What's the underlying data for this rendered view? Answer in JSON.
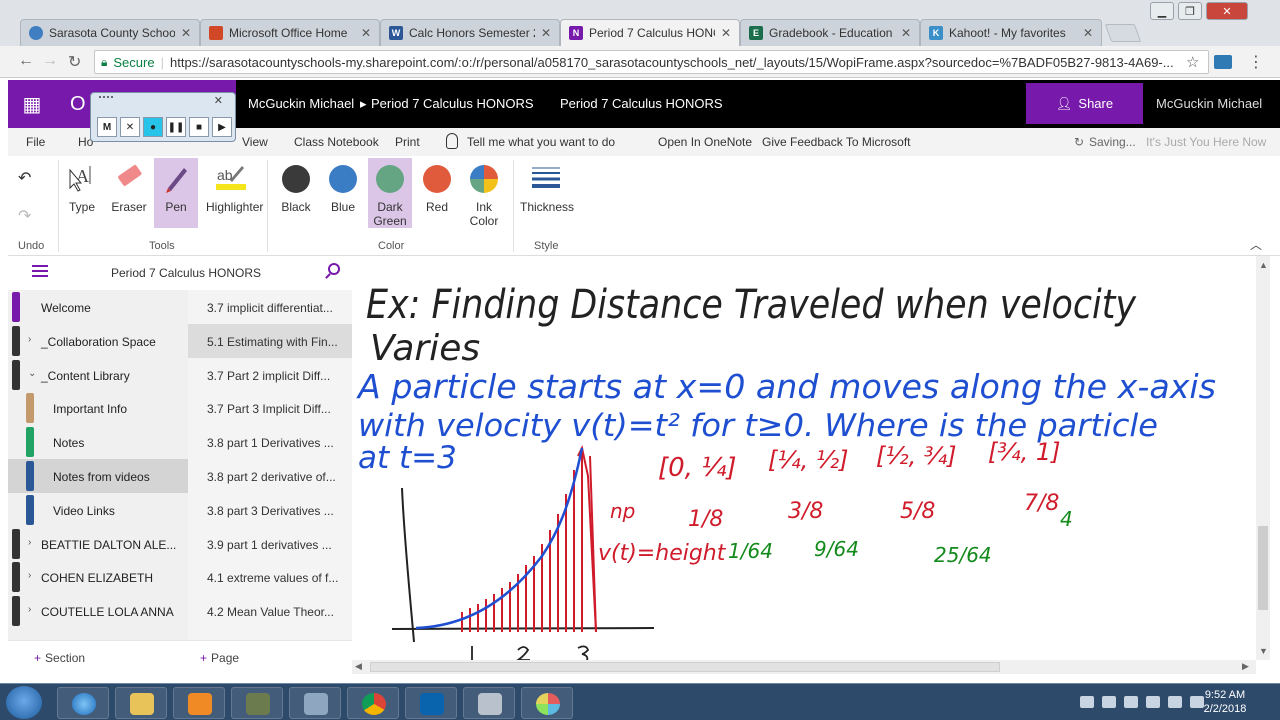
{
  "browser": {
    "tabs": [
      {
        "title": "Sarasota County Schools",
        "icon_color": "#3f7fc1",
        "active": false
      },
      {
        "title": "Microsoft Office Home",
        "icon_color": "#d24726",
        "active": false
      },
      {
        "title": "Calc Honors Semester 2",
        "icon_color": "#2b5797",
        "active": false
      },
      {
        "title": "Period 7 Calculus HONORS",
        "icon_color": "#7719aa",
        "active": true
      },
      {
        "title": "Gradebook - Education",
        "icon_color": "#1b6e4b",
        "active": false
      },
      {
        "title": "Kahoot! - My favorites",
        "icon_color": "#3a8fc9",
        "active": false
      }
    ],
    "tab_close": "✕",
    "secure_label": "Secure",
    "url": "https://sarasotacountyschools-my.sharepoint.com/:o:/r/personal/a058170_sarasotacountyschools_net/_layouts/15/WopiFrame.aspx?sourcedoc=%7BADF05B27-9813-4A69-..."
  },
  "office": {
    "brand": "O",
    "breadcrumb_user": "McGuckin Michael",
    "breadcrumb_notebook": "Period 7 Calculus HONORS",
    "page_notebook": "Period 7 Calculus HONORS",
    "share_label": "Share",
    "user_name": "McGuckin Michael"
  },
  "recorder": {
    "mode_label": "M",
    "close": "✕"
  },
  "ribbon_tabs": {
    "file": "File",
    "home": "Ho",
    "view": "View",
    "class_notebook": "Class Notebook",
    "print": "Print",
    "tell_me": "Tell me what you want to do",
    "open_in_onenote": "Open In OneNote",
    "feedback": "Give Feedback To Microsoft",
    "saving": "Saving...",
    "presence": "It's Just You Here Now"
  },
  "ribbon": {
    "tools": [
      {
        "label": "Type"
      },
      {
        "label": "Eraser"
      },
      {
        "label": "Pen"
      },
      {
        "label": "Highlighter"
      }
    ],
    "colors": [
      {
        "label": "Black",
        "color": "#3a3a3a"
      },
      {
        "label": "Blue",
        "color": "#3b7dc4"
      },
      {
        "label": "Dark Green",
        "color": "#66a584"
      },
      {
        "label": "Red",
        "color": "#e05a3c"
      }
    ],
    "ink_color_label": "Ink Color",
    "thickness_label": "Thickness",
    "groups": {
      "undo": "Undo",
      "tools": "Tools",
      "color": "Color",
      "style": "Style"
    }
  },
  "nav": {
    "notebook_title": "Period 7 Calculus HONORS",
    "sections": [
      {
        "label": "Welcome",
        "color": "#7719aa",
        "expandable": false,
        "indent": false
      },
      {
        "label": "_Collaboration Space",
        "color": "",
        "expandable": true,
        "indent": false
      },
      {
        "label": "_Content Library",
        "color": "",
        "expandable": true,
        "indent": false
      },
      {
        "label": "Important Info",
        "color": "#c49a6c",
        "expandable": false,
        "indent": true
      },
      {
        "label": "Notes",
        "color": "#21a366",
        "expandable": false,
        "indent": true
      },
      {
        "label": "Notes from videos",
        "color": "#2b5797",
        "expandable": false,
        "indent": true
      },
      {
        "label": "Video Links",
        "color": "#2b5797",
        "expandable": false,
        "indent": true
      },
      {
        "label": "BEATTIE DALTON ALE...",
        "color": "",
        "expandable": true,
        "indent": false
      },
      {
        "label": "COHEN ELIZABETH",
        "color": "",
        "expandable": true,
        "indent": false
      },
      {
        "label": "COUTELLE LOLA ANNA",
        "color": "",
        "expandable": true,
        "indent": false
      }
    ],
    "pages": [
      "3.7 implicit differentiat...",
      "5.1 Estimating with Fin...",
      "3.7 Part 2 implicit Diff...",
      "3.7 Part 3 Implicit Diff...",
      "3.8 part 1 Derivatives ...",
      "3.8 part 2 derivative of...",
      "3.8 part 3 Derivatives ...",
      "3.9 part 1 derivatives ...",
      "4.1 extreme values of f...",
      "4.2 Mean Value Theor..."
    ],
    "add_section": "Section",
    "add_page": "Page"
  },
  "taskbar": {
    "time": "9:52 AM",
    "date": "2/2/2018"
  }
}
